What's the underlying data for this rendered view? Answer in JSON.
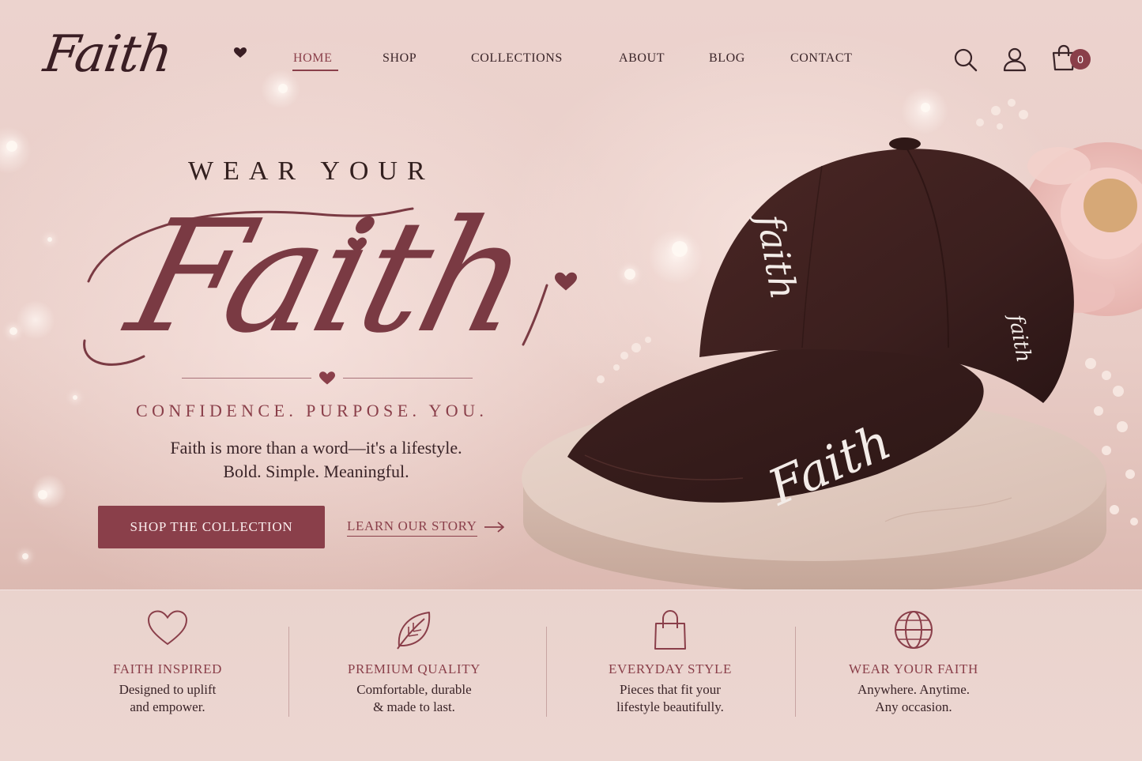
{
  "brand": {
    "logo_text": "Faith"
  },
  "nav": {
    "items": [
      "HOME",
      "SHOP",
      "COLLECTIONS",
      "ABOUT",
      "BLOG",
      "CONTACT"
    ],
    "active": "HOME"
  },
  "header_icons": {
    "search": "search-icon",
    "account": "user-icon",
    "cart": "shopping-bag-icon",
    "cart_count": "0"
  },
  "hero": {
    "eyebrow": "WEAR YOUR",
    "script_title": "Faith",
    "tagline": "CONFIDENCE. PURPOSE. YOU.",
    "copy_line1": "Faith is more than a word—it's a lifestyle.",
    "copy_line2": "Bold. Simple. Meaningful.",
    "primary_cta": "SHOP THE COLLECTION",
    "secondary_cta": "LEARN OUR STORY"
  },
  "product": {
    "cap_front_text": "faith",
    "cap_brim_text": "Faith",
    "cap_side_text": "faith"
  },
  "features": [
    {
      "icon": "heart-icon",
      "title": "FAITH INSPIRED",
      "line1": "Designed to uplift",
      "line2": "and empower."
    },
    {
      "icon": "leaf-icon",
      "title": "PREMIUM QUALITY",
      "line1": "Comfortable, durable",
      "line2": "& made to last."
    },
    {
      "icon": "shopping-bag-icon",
      "title": "EVERYDAY STYLE",
      "line1": "Pieces that fit your",
      "line2": "lifestyle beautifully."
    },
    {
      "icon": "globe-icon",
      "title": "WEAR YOUR FAITH",
      "line1": "Anywhere. Anytime.",
      "line2": "Any occasion."
    }
  ],
  "colors": {
    "accent": "#8a3f4a",
    "cap": "#3b1f1e",
    "background": "#ecd3ce"
  }
}
